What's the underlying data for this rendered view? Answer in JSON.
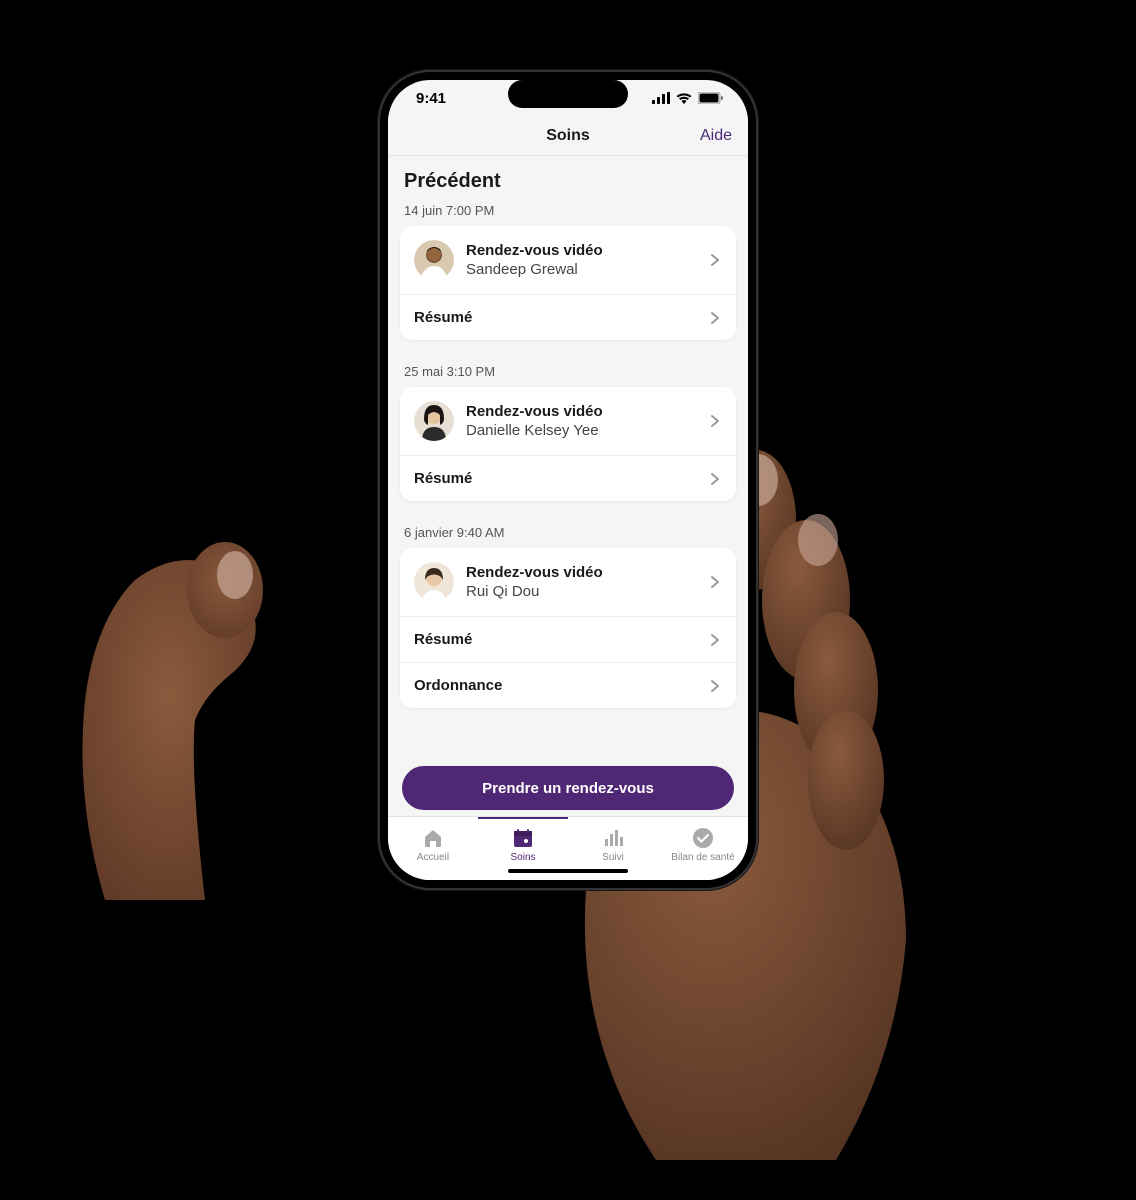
{
  "colors": {
    "accent": "#502775"
  },
  "status": {
    "time": "9:41"
  },
  "nav": {
    "title": "Soins",
    "help": "Aide"
  },
  "section": {
    "title": "Précédent"
  },
  "actions": {
    "summary": "Résumé",
    "prescription": "Ordonnance"
  },
  "appointments": [
    {
      "date": "14 juin 7:00 PM",
      "type": "Rendez-vous vidéo",
      "provider": "Sandeep Grewal"
    },
    {
      "date": "25 mai 3:10 PM",
      "type": "Rendez-vous vidéo",
      "provider": "Danielle Kelsey Yee"
    },
    {
      "date": "6 janvier 9:40 AM",
      "type": "Rendez-vous vidéo",
      "provider": "Rui Qi Dou"
    }
  ],
  "cta": {
    "label": "Prendre un rendez-vous"
  },
  "tabs": {
    "home": "Accueil",
    "care": "Soins",
    "tracking": "Suivi",
    "health": "Bilan de santé"
  }
}
